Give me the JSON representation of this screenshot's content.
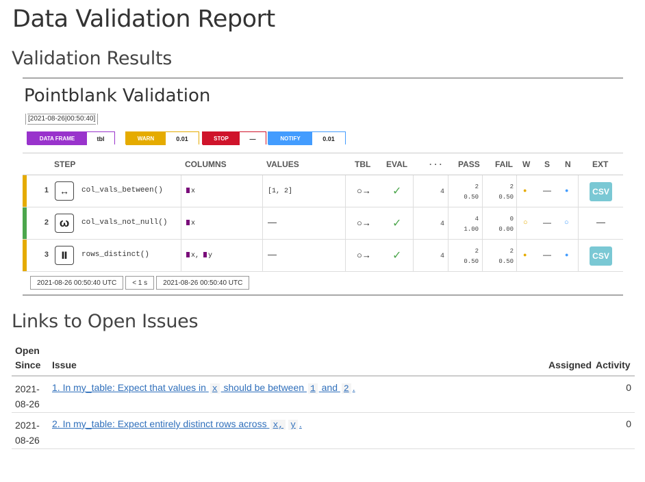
{
  "page": {
    "title": "Data Validation Report",
    "results_heading": "Validation Results",
    "links_heading": "Links to Open Issues"
  },
  "pointblank": {
    "title": "Pointblank Validation",
    "timestamp": "[2021-08-26|00:50:40]",
    "badges": {
      "data_frame_label": "DATA FRAME",
      "data_frame_value": "tbl",
      "warn_label": "WARN",
      "warn_value": "0.01",
      "stop_label": "STOP",
      "stop_value": "—",
      "notify_label": "NOTIFY",
      "notify_value": "0.01"
    },
    "colors": {
      "data_frame": "#9933CC",
      "warn": "#E5AB00",
      "stop": "#CF142B",
      "notify": "#439CFE",
      "pass_bar": "#4CA64C",
      "warn_bar": "#E5AB00",
      "csv": "#7AC8D4"
    },
    "headers": {
      "step": "STEP",
      "columns": "COLUMNS",
      "values": "VALUES",
      "tbl": "TBL",
      "eval": "EVAL",
      "units": "· · ·",
      "pass": "PASS",
      "fail": "FAIL",
      "w": "W",
      "s": "S",
      "n": "N",
      "ext": "EXT"
    },
    "rows": [
      {
        "num": "1",
        "icon": "between-icon",
        "icon_glyph": "↔",
        "step": "col_vals_between()",
        "columns": "x",
        "values": "[1, 2]",
        "tbl": "○→",
        "eval": "✓",
        "units": "4",
        "pass_n": "2",
        "pass_f": "0.50",
        "fail_n": "2",
        "fail_f": "0.50",
        "w": "●",
        "s": "—",
        "n": "●",
        "ext": "CSV",
        "status": "warn"
      },
      {
        "num": "2",
        "icon": "not-null-icon",
        "icon_glyph": "ω",
        "step": "col_vals_not_null()",
        "columns": "x",
        "values": "—",
        "tbl": "○→",
        "eval": "✓",
        "units": "4",
        "pass_n": "4",
        "pass_f": "1.00",
        "fail_n": "0",
        "fail_f": "0.00",
        "w": "○",
        "s": "—",
        "n": "○",
        "ext": "—",
        "status": "pass"
      },
      {
        "num": "3",
        "icon": "distinct-icon",
        "icon_glyph": "Ⅱ",
        "step": "rows_distinct()",
        "columns_a": "x,",
        "columns_b": "y",
        "values": "—",
        "tbl": "○→",
        "eval": "✓",
        "units": "4",
        "pass_n": "2",
        "pass_f": "0.50",
        "fail_n": "2",
        "fail_f": "0.50",
        "w": "●",
        "s": "—",
        "n": "●",
        "ext": "CSV",
        "status": "warn"
      }
    ],
    "stamps": {
      "start": "2021-08-26 00:50:40 UTC",
      "duration": "< 1 s",
      "end": "2021-08-26 00:50:40 UTC"
    }
  },
  "issues": {
    "headers": {
      "open_since_1": "Open",
      "open_since_2": "Since",
      "issue": "Issue",
      "assigned": "Assigned",
      "activity": "Activity"
    },
    "rows": [
      {
        "date_1": "2021-",
        "date_2": "08-26",
        "text_a": "1. In my_table: Expect that values in",
        "code_a": "x",
        "text_b": "should be between",
        "code_b": "1",
        "text_c": "and",
        "code_c": "2",
        "text_d": ".",
        "activity": "0"
      },
      {
        "date_1": "2021-",
        "date_2": "08-26",
        "text_a": "2. In my_table: Expect entirely distinct rows across",
        "code_a": "x,",
        "code_b": "y",
        "text_d": ".",
        "activity": "0"
      }
    ]
  }
}
